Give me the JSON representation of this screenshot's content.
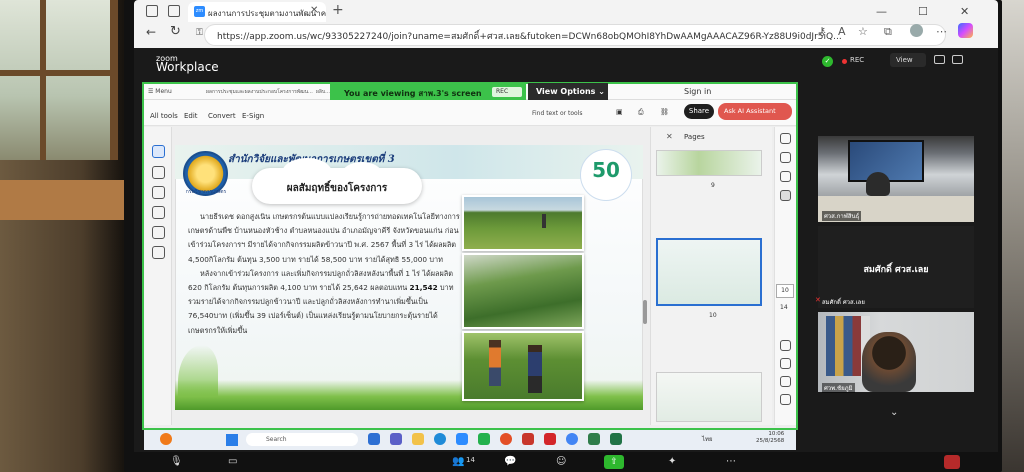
{
  "browser": {
    "tab_title": "ผลงานการประชุมตามงานพัฒนาความรู้การพัฒนาท้องถิ่น",
    "tab_favicon_text": "zm",
    "url": "https://app.zoom.us/wc/93305227240/join?uname=สมศักดิ์+ศวส.เลย&futoken=DCWn68obQMOhI8YhDwAAMgAAACAZ96R-Yz88U9i0dJr5iQ..."
  },
  "zoom": {
    "logo_line1": "zoom",
    "logo_line2": "Workplace",
    "rec_label": "REC",
    "view_label": "View",
    "banner_text": "You are viewing สาพ.3's screen",
    "banner_rec": "REC",
    "view_options": "View Options",
    "participants_count": "14"
  },
  "acrobat": {
    "menu_label": "Menu",
    "doc_tab_1": "ผลการประชุมและผลงานประกอบโครงการพัฒน...",
    "doc_tab_2": "ผลิบ...",
    "sign_in": "Sign in",
    "toolbar": [
      "All tools",
      "Edit",
      "Convert",
      "E-Sign"
    ],
    "find_text": "Find text or tools",
    "share_button": "Share",
    "ai_button": "Ask AI Assistant",
    "pages_label": "Pages",
    "page_9": "9",
    "page_10": "10",
    "page_current": "10",
    "page_total": "14"
  },
  "slide": {
    "org_name": "สำนักวิจัยและพัฒนาการเกษตรเขตที่ 3",
    "seal_label": "กรมวิชาการเกษตร",
    "logo_50_text": "50",
    "title": "ผลสัมฤทธิ์ของโครงการ",
    "para1": "นายธีรเดช ดอกสูงเนิน เกษตรกรต้นแบบแปลงเรียนรู้การถ่ายทอดเทคโนโลยีทางการเกษตรด้านพืช บ้านหนองหัวช้าง ตำบลหนองแปน อำเภอมัญจาคีรี จังหวัดขอนแก่น ก่อนเข้าร่วมโครงการฯ มีรายได้จากกิจกรรมผลิตข้าวนาปี พ.ศ. 2567 พื้นที่ 3 ไร่ ได้ผลผลิต 4,500กิโลกรัม ต้นทุน 3,500 บาท รายได้ 58,500 บาท รายได้สุทธิ 55,000 บาท",
    "para2_before": "หลังจากเข้าร่วมโครงการ และเพิ่มกิจกรรมปลูกถั่วลิสงหลังนาพื้นที่ 1 ไร่ ได้ผลผลิต 620 กิโลกรัม ต้นทุนการผลิต 4,100 บาท รายได้ 25,642 ผลตอบแทน ",
    "para2_bold": "21,542",
    "para2_after": " บาท รวมรายได้จากกิจกรรมปลูกข้าวนาปี และปลูกถั่วลิสงหลังการทำนาเพิ่มขึ้นเป็น 76,540บาท (เพิ่มขึ้น 39 เปอร์เซ็นต์) เป็นแหล่งเรียนรู้ตามนโยบายกระตุ้นรายได้เกษตรกรให้เพิ่มขึ้น"
  },
  "taskbar": {
    "search_label": "Search",
    "time": "10:06",
    "date": "25/8/2568",
    "lang": "ไทย"
  },
  "participants": [
    {
      "name": "ศวส.กาฬสินธุ์"
    },
    {
      "name": "สมศักดิ์ ศวส.เลย",
      "sub": "สมศักดิ์ ศวส.เลย"
    },
    {
      "name": "ศวพ.ชัยภูมิ"
    }
  ]
}
